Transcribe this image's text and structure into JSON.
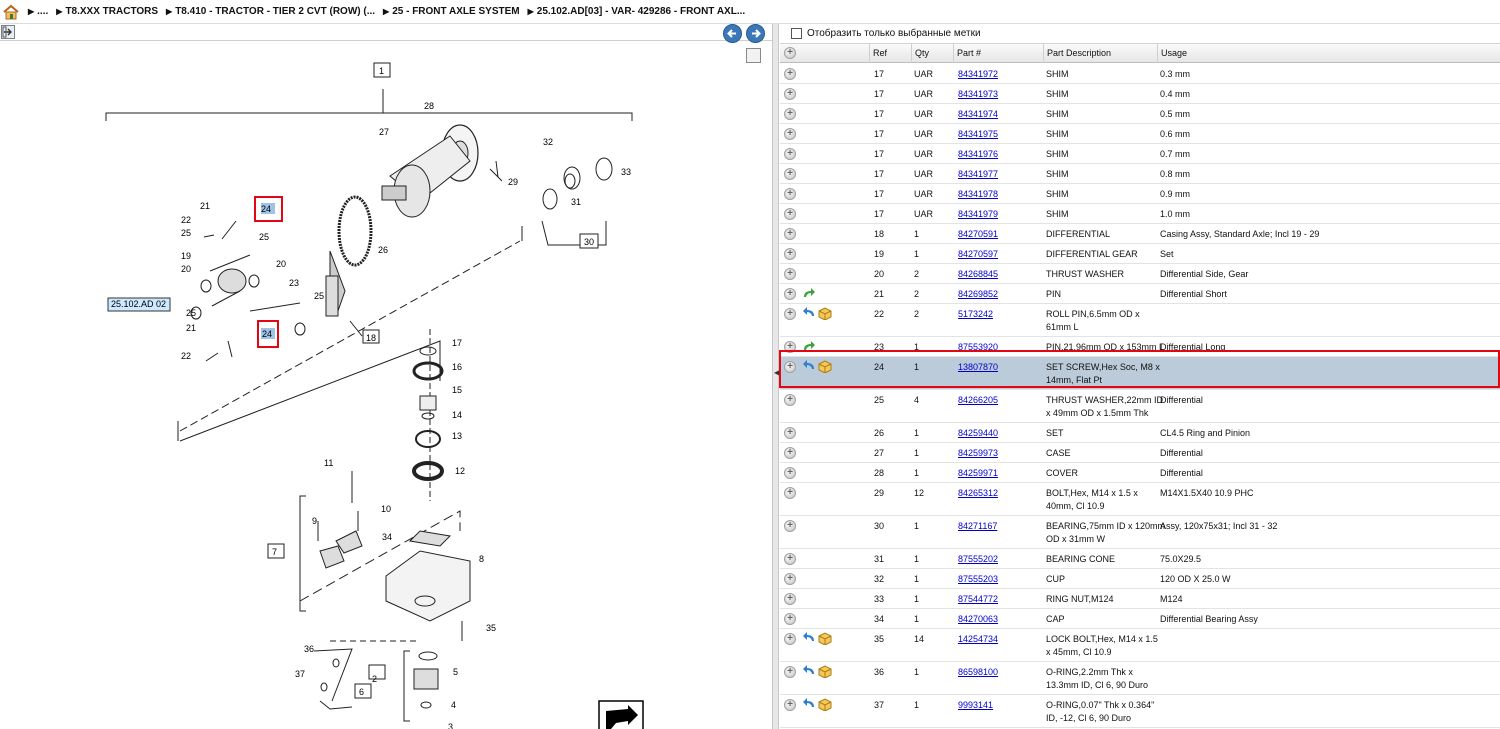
{
  "breadcrumb": {
    "items": [
      "....",
      "T8.XXX TRACTORS",
      "T8.410 - TRACTOR - TIER 2 CVT (ROW) (...",
      "25 - FRONT AXLE SYSTEM",
      "25.102.AD[03] - VAR- 429286 - FRONT AXL..."
    ]
  },
  "icons": {
    "home": "home-icon",
    "export": "export-icon",
    "back": "back-arrow-icon",
    "forward": "forward-arrow-icon",
    "expand": "plus-circle-icon",
    "alternate": "green-arrow-icon",
    "replacement": "blue-arrow-icon",
    "kit": "box-icon"
  },
  "colors": {
    "selected_row": "#bccbd9",
    "highlight_border": "#e30613",
    "link": "#0000cc",
    "nav_button": "#3c78b8"
  },
  "diagram": {
    "page_label": "25.102.AD 02",
    "callouts": [
      "1",
      "2",
      "3",
      "4",
      "5",
      "6",
      "7",
      "8",
      "9",
      "10",
      "11",
      "12",
      "13",
      "14",
      "15",
      "16",
      "17",
      "18",
      "19",
      "20",
      "20",
      "21",
      "21",
      "22",
      "22",
      "23",
      "24",
      "24",
      "25",
      "25",
      "25",
      "25",
      "26",
      "27",
      "28",
      "29",
      "30",
      "31",
      "32",
      "33",
      "34",
      "35",
      "36",
      "37"
    ]
  },
  "filter": {
    "label": "Отобразить только выбранные метки",
    "checked": false
  },
  "table": {
    "columns": [
      "Ref",
      "Qty",
      "Part #",
      "Part Description",
      "Usage"
    ],
    "selected_ref": "24",
    "rows": [
      {
        "icons": [],
        "ref": "17",
        "qty": "UAR",
        "part": "84341972",
        "desc": [
          "SHIM"
        ],
        "usage": "0.3 mm"
      },
      {
        "icons": [],
        "ref": "17",
        "qty": "UAR",
        "part": "84341973",
        "desc": [
          "SHIM"
        ],
        "usage": "0.4 mm"
      },
      {
        "icons": [],
        "ref": "17",
        "qty": "UAR",
        "part": "84341974",
        "desc": [
          "SHIM"
        ],
        "usage": "0.5 mm"
      },
      {
        "icons": [],
        "ref": "17",
        "qty": "UAR",
        "part": "84341975",
        "desc": [
          "SHIM"
        ],
        "usage": "0.6 mm"
      },
      {
        "icons": [],
        "ref": "17",
        "qty": "UAR",
        "part": "84341976",
        "desc": [
          "SHIM"
        ],
        "usage": "0.7 mm"
      },
      {
        "icons": [],
        "ref": "17",
        "qty": "UAR",
        "part": "84341977",
        "desc": [
          "SHIM"
        ],
        "usage": "0.8 mm"
      },
      {
        "icons": [],
        "ref": "17",
        "qty": "UAR",
        "part": "84341978",
        "desc": [
          "SHIM"
        ],
        "usage": "0.9 mm"
      },
      {
        "icons": [],
        "ref": "17",
        "qty": "UAR",
        "part": "84341979",
        "desc": [
          "SHIM"
        ],
        "usage": "1.0 mm"
      },
      {
        "icons": [],
        "ref": "18",
        "qty": "1",
        "part": "84270591",
        "desc": [
          "DIFFERENTIAL"
        ],
        "usage": "Casing Assy, Standard Axle; Incl 19 - 29"
      },
      {
        "icons": [],
        "ref": "19",
        "qty": "1",
        "part": "84270597",
        "desc": [
          "DIFFERENTIAL GEAR"
        ],
        "usage": "Set"
      },
      {
        "icons": [],
        "ref": "20",
        "qty": "2",
        "part": "84268845",
        "desc": [
          "THRUST WASHER"
        ],
        "usage": "Differential Side, Gear"
      },
      {
        "icons": [
          "alternate"
        ],
        "ref": "21",
        "qty": "2",
        "part": "84269852",
        "desc": [
          "PIN"
        ],
        "usage": "Differential Short"
      },
      {
        "icons": [
          "replacement",
          "kit"
        ],
        "ref": "22",
        "qty": "2",
        "part": "5173242",
        "desc": [
          "ROLL PIN,6.5mm OD x",
          "61mm L"
        ],
        "usage": ""
      },
      {
        "icons": [
          "alternate"
        ],
        "ref": "23",
        "qty": "1",
        "part": "87553920",
        "desc": [
          "PIN,21.96mm OD x 153mm L"
        ],
        "usage": "Differential Long"
      },
      {
        "icons": [
          "replacement",
          "kit"
        ],
        "ref": "24",
        "qty": "1",
        "part": "13807870",
        "desc": [
          "SET SCREW,Hex Soc, M8 x",
          "14mm, Flat Pt"
        ],
        "usage": ""
      },
      {
        "icons": [],
        "ref": "25",
        "qty": "4",
        "part": "84266205",
        "desc": [
          "THRUST WASHER,22mm ID",
          "x 49mm OD x 1.5mm Thk"
        ],
        "usage": "Differential"
      },
      {
        "icons": [],
        "ref": "26",
        "qty": "1",
        "part": "84259440",
        "desc": [
          "SET"
        ],
        "usage": "CL4.5 Ring and Pinion"
      },
      {
        "icons": [],
        "ref": "27",
        "qty": "1",
        "part": "84259973",
        "desc": [
          "CASE"
        ],
        "usage": "Differential"
      },
      {
        "icons": [],
        "ref": "28",
        "qty": "1",
        "part": "84259971",
        "desc": [
          "COVER"
        ],
        "usage": "Differential"
      },
      {
        "icons": [],
        "ref": "29",
        "qty": "12",
        "part": "84265312",
        "desc": [
          "BOLT,Hex, M14 x 1.5 x",
          "40mm, Cl 10.9"
        ],
        "usage": "M14X1.5X40 10.9 PHC"
      },
      {
        "icons": [],
        "ref": "30",
        "qty": "1",
        "part": "84271167",
        "desc": [
          "BEARING,75mm ID x 120mm",
          "OD x 31mm W"
        ],
        "usage": "Assy, 120x75x31; Incl 31 - 32"
      },
      {
        "icons": [],
        "ref": "31",
        "qty": "1",
        "part": "87555202",
        "desc": [
          "BEARING CONE"
        ],
        "usage": "75.0X29.5"
      },
      {
        "icons": [],
        "ref": "32",
        "qty": "1",
        "part": "87555203",
        "desc": [
          "CUP"
        ],
        "usage": "120 OD X 25.0 W"
      },
      {
        "icons": [],
        "ref": "33",
        "qty": "1",
        "part": "87544772",
        "desc": [
          "RING NUT,M124"
        ],
        "usage": "M124"
      },
      {
        "icons": [],
        "ref": "34",
        "qty": "1",
        "part": "84270063",
        "desc": [
          "CAP"
        ],
        "usage": "Differential Bearing Assy"
      },
      {
        "icons": [
          "replacement",
          "kit"
        ],
        "ref": "35",
        "qty": "14",
        "part": "14254734",
        "desc": [
          "LOCK BOLT,Hex, M14 x 1.5",
          "x 45mm, Cl 10.9"
        ],
        "usage": ""
      },
      {
        "icons": [
          "replacement",
          "kit"
        ],
        "ref": "36",
        "qty": "1",
        "part": "86598100",
        "desc": [
          "O-RING,2.2mm Thk x",
          "13.3mm ID, Cl 6, 90 Duro"
        ],
        "usage": ""
      },
      {
        "icons": [
          "replacement",
          "kit"
        ],
        "ref": "37",
        "qty": "1",
        "part": "9993141",
        "desc": [
          "O-RING,0.07\" Thk x 0.364\"",
          "ID, -12, Cl 6, 90 Duro"
        ],
        "usage": ""
      }
    ]
  }
}
